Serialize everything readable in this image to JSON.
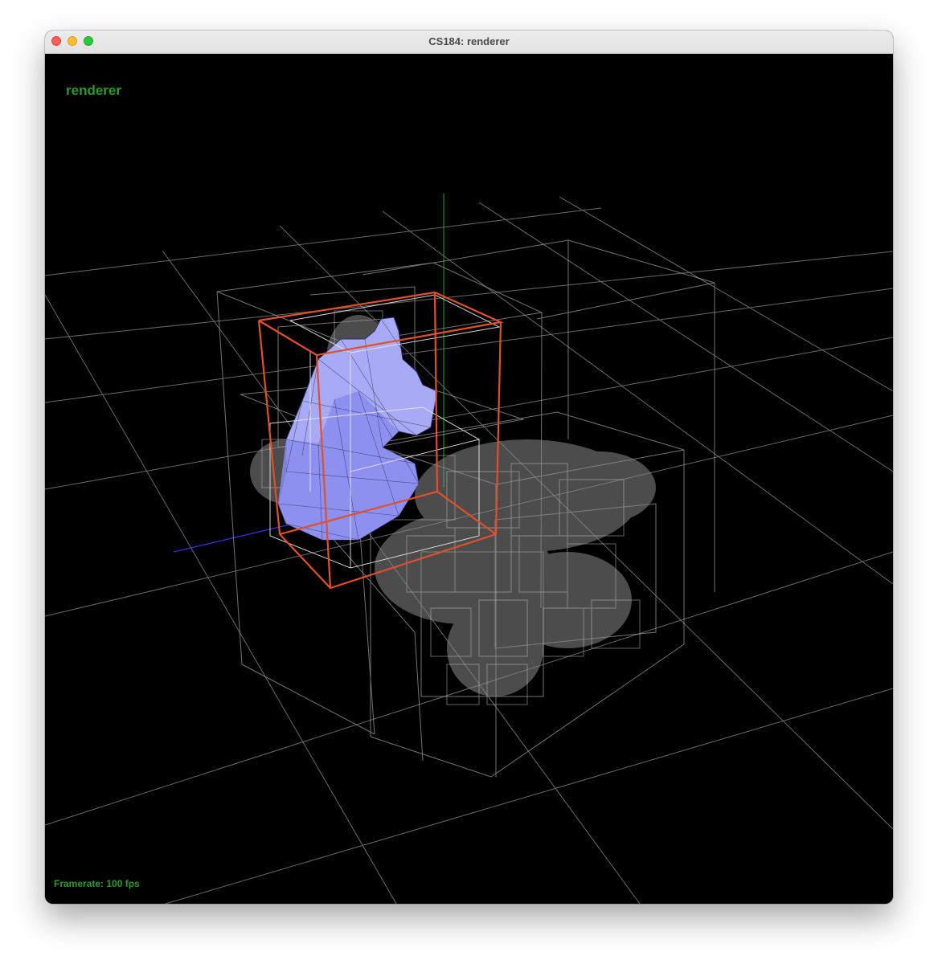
{
  "window": {
    "title": "CS184: renderer"
  },
  "viewport": {
    "overlay_label": "renderer",
    "framerate": "Framerate: 100 fps"
  },
  "colors": {
    "overlay_text": "#2a9a2a",
    "selected_bbox": "#e0502a",
    "mesh_fill": "#9a9cf0",
    "axis_y": "#1faa1f",
    "axis_x": "#3a3aff",
    "grid": "#8a8a8a"
  },
  "icons": [
    "close-light",
    "minimize-light",
    "maximize-light"
  ]
}
